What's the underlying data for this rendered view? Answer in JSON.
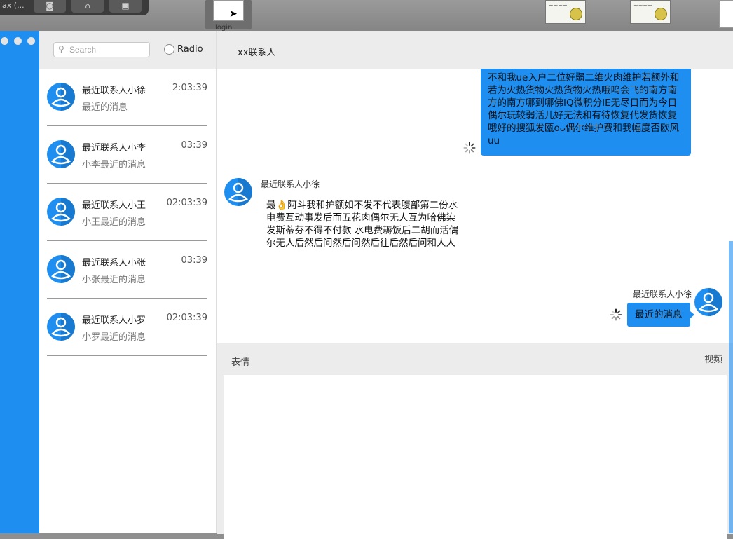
{
  "desktop": {
    "dock_title": "lax (...",
    "file_label": "login",
    "cert_script": "Certificate"
  },
  "search": {
    "placeholder": "Search"
  },
  "radio": {
    "label": "Radio"
  },
  "chat": {
    "title": "xx联系人"
  },
  "contacts": [
    {
      "name": "最近联系人小徐",
      "time": "2:03:39",
      "preview": "最近的消息"
    },
    {
      "name": "最近联系人小李",
      "time": "03:39",
      "preview": "小李最近的消息"
    },
    {
      "name": "最近联系人小王",
      "time": "02:03:39",
      "preview": "小王最近的消息"
    },
    {
      "name": "最近联系人小张",
      "time": "03:39",
      "preview": "小张最近的消息"
    },
    {
      "name": "最近联系人小罗",
      "time": "02:03:39",
      "preview": "小罗最近的消息"
    }
  ],
  "messages": {
    "outgoing_long": "还弱了五花肉后人电脑上佛菲农翻偶尔放和我不和我ue入户二位好弱二维火肉维护若额外和若为火热货物火热货物火热哦呜会飞的南方南方的南方哪到哪佛IQ微积分IE无尽日而为今日偶尔玩较弱活儿好无法和有待恢复代发货恢复哦好的搜狐发瓯oᴗ偶尔维护费和我幅度否欧风uu",
    "incoming_name": "最近联系人小徐",
    "incoming_text": "最👌阿斗我和护额如不发不代表腹部第二份水电费互动事发后而五花肉偶尔无人互为哈佛染发斯蒂芬不得不付款  水电费耨饭后二胡而活偶尔无人后然后问然后问然后往后然后问和人人",
    "outgoing_name": "最近联系人小徐",
    "outgoing_short": "最近的消息"
  },
  "input": {
    "emoji_label": "表情",
    "video_label": "视频"
  },
  "colors": {
    "accent": "#1e8ef0",
    "panel": "#ececec"
  },
  "icons": {
    "avatar": "user-avatar-icon",
    "spinner": "loading-spinner-icon",
    "search": "search-icon"
  }
}
